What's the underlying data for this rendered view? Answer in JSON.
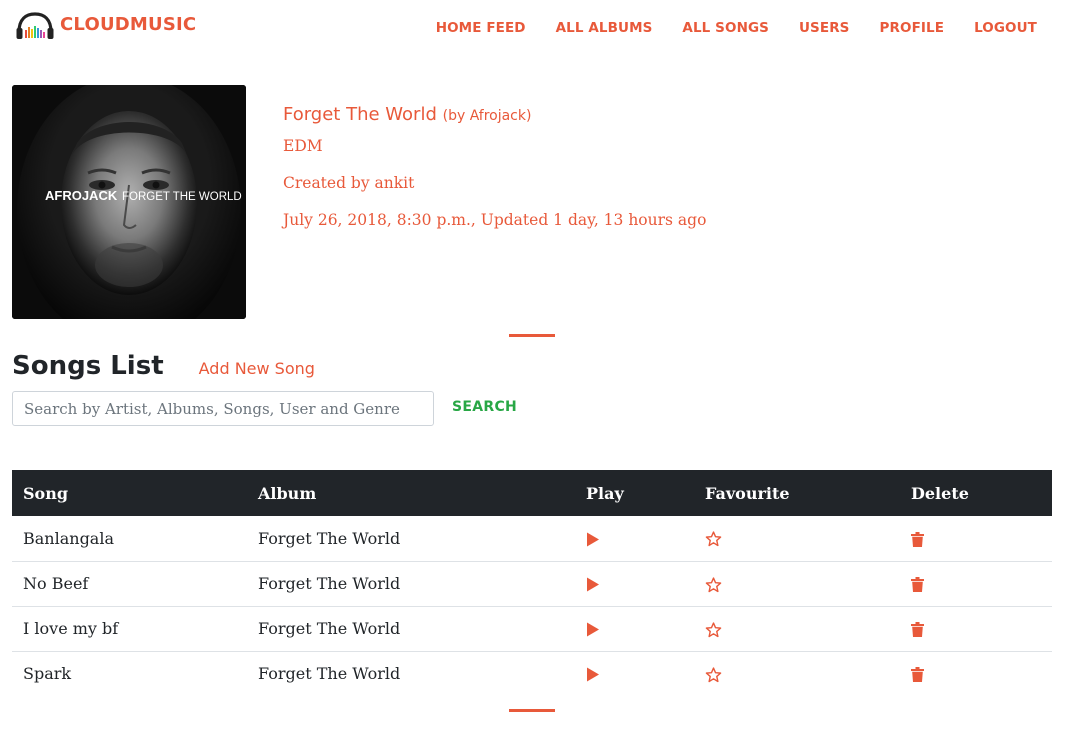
{
  "app": {
    "brand": "CLOUDMUSIC",
    "logo_icon": "headphones-equalizer-icon"
  },
  "nav": {
    "items": [
      {
        "label": "HOME FEED"
      },
      {
        "label": "ALL ALBUMS"
      },
      {
        "label": "ALL SONGS"
      },
      {
        "label": "USERS"
      },
      {
        "label": "PROFILE"
      },
      {
        "label": "LOGOUT"
      }
    ]
  },
  "album": {
    "title": "Forget The World",
    "artist": "(by Afrojack)",
    "genre": "EDM",
    "created_by": "Created by ankit",
    "date_line": "July 26, 2018, 8:30 p.m., Updated 1 day, 13 hours ago",
    "cover": {
      "artist_text": "AFROJACK",
      "title_text": "FORGET THE WORLD"
    }
  },
  "songs_section": {
    "title": "Songs List",
    "add_label": "Add New Song"
  },
  "search": {
    "placeholder": "Search by Artist, Albums, Songs, User and Genre",
    "value": "",
    "button_label": "SEARCH"
  },
  "table": {
    "headers": {
      "song": "Song",
      "album": "Album",
      "play": "Play",
      "favourite": "Favourite",
      "delete": "Delete"
    },
    "rows": [
      {
        "song": "Banlangala",
        "album": "Forget The World"
      },
      {
        "song": "No Beef",
        "album": "Forget The World"
      },
      {
        "song": "I love my bf",
        "album": "Forget The World"
      },
      {
        "song": "Spark",
        "album": "Forget The World"
      }
    ],
    "row_icons": {
      "play": "play-icon",
      "favourite": "star-outline-icon",
      "delete": "trash-icon"
    }
  },
  "colors": {
    "accent": "#e8593a",
    "search_button": "#28a745",
    "table_header_bg": "#212529"
  }
}
